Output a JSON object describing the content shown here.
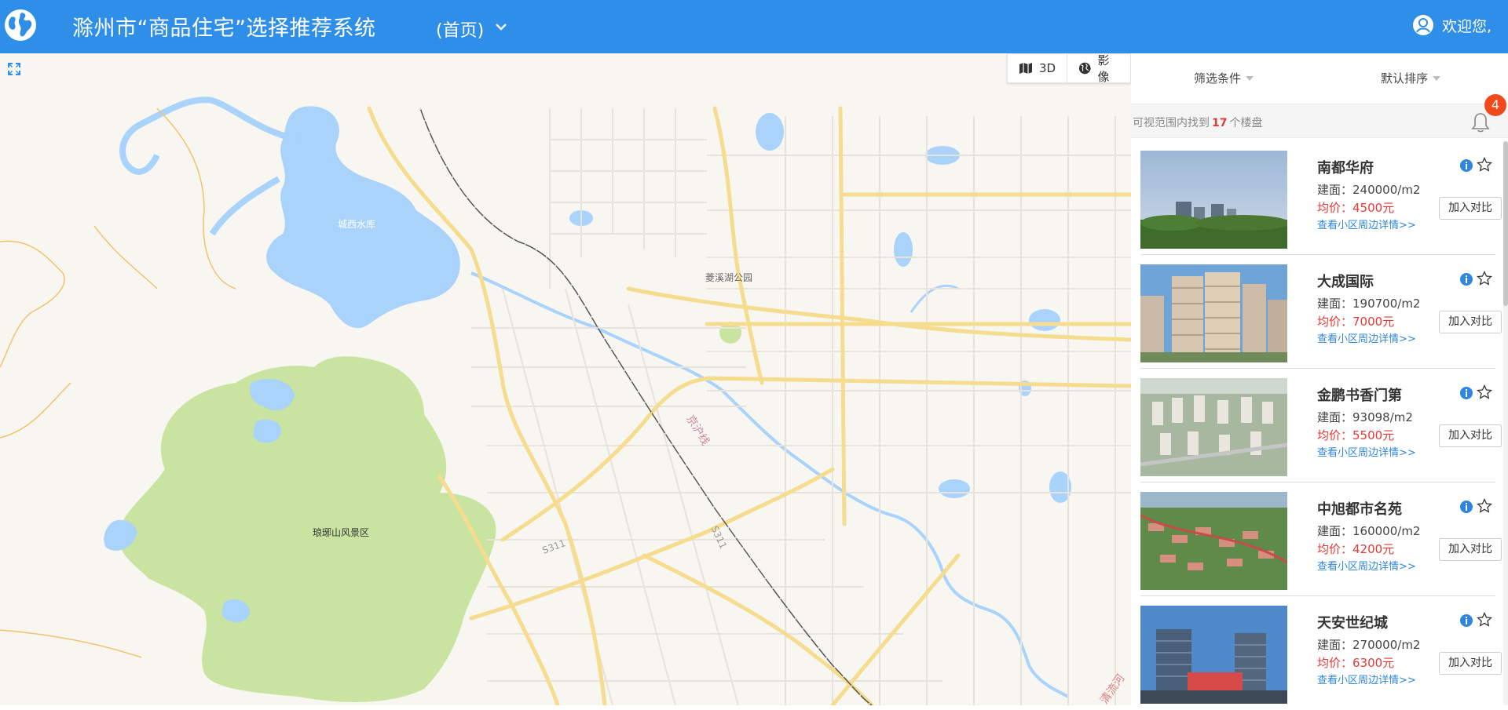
{
  "header": {
    "title": "滁州市“商品住宅”选择推荐系统",
    "subtitle": "(首页)",
    "welcome": "欢迎您,",
    "bg_color": "#2e8ee8",
    "icons": [
      "globe-icon",
      "chevron-down-icon",
      "user-icon"
    ]
  },
  "map": {
    "controls": {
      "three_d": "3D",
      "imagery": "影像"
    },
    "labels": {
      "reservoir": "城西水库",
      "park": "菱溪湖公园",
      "scenic": "琅琊山风景区",
      "road_s311a": "S311",
      "road_s311b": "S311",
      "railway": "京沪线",
      "river": "清流河"
    }
  },
  "panel": {
    "filter_label": "筛选条件",
    "sort_label": "默认排序",
    "count_prefix": "可视范围内找到",
    "count_value": "17",
    "count_suffix": "个楼盘",
    "notification_count": "4",
    "compare_label": "加入对比",
    "detail_label": "查看小区周边详情>>",
    "items": [
      {
        "name": "南都华府",
        "area": "建面：240000/m2",
        "price": "均价：4500元"
      },
      {
        "name": "大成国际",
        "area": "建面：190700/m2",
        "price": "均价：7000元"
      },
      {
        "name": "金鹏书香门第",
        "area": "建面：93098/m2",
        "price": "均价：5500元"
      },
      {
        "name": "中旭都市名苑",
        "area": "建面：160000/m2",
        "price": "均价：4200元"
      },
      {
        "name": "天安世纪城",
        "area": "建面：270000/m2",
        "price": "均价：6300元"
      }
    ]
  }
}
